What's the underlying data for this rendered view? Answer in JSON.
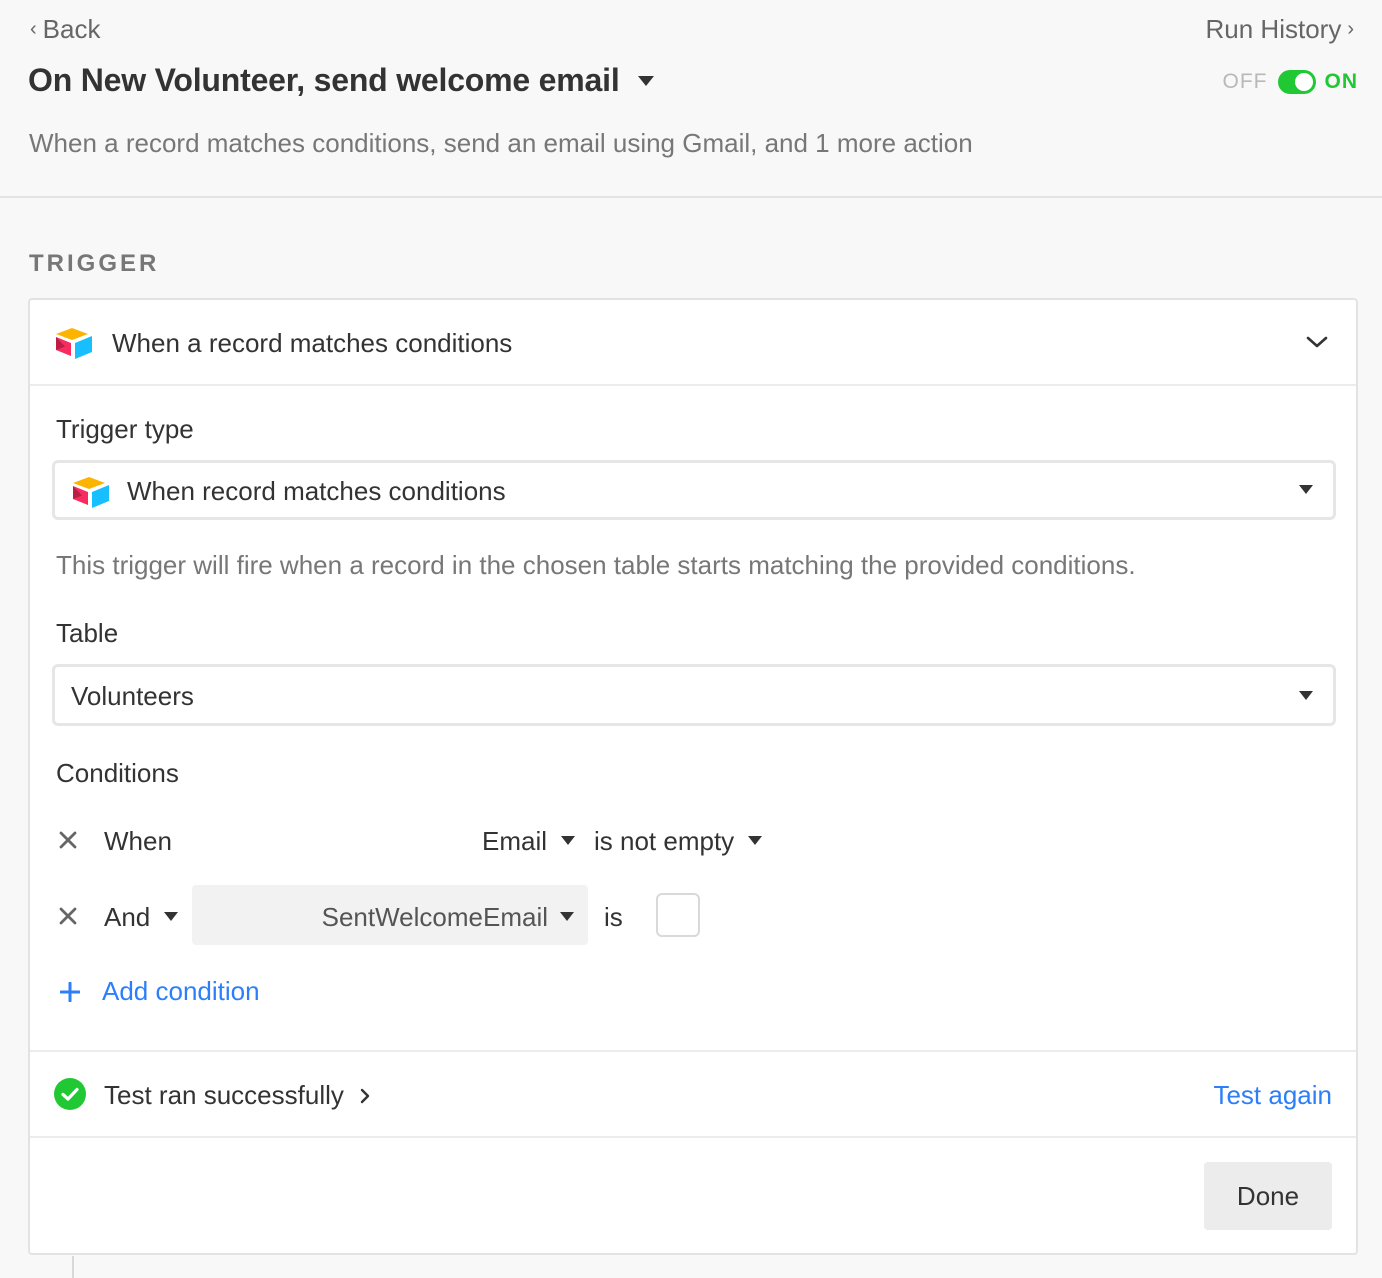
{
  "header": {
    "back_label": "Back",
    "run_history_label": "Run History",
    "title": "On New Volunteer, send welcome email",
    "toggle_off_label": "OFF",
    "toggle_on_label": "ON",
    "subtitle": "When a record matches conditions, send an email using Gmail, and 1 more action"
  },
  "trigger": {
    "section_label": "TRIGGER",
    "card_title": "When a record matches conditions",
    "trigger_type_label": "Trigger type",
    "trigger_type_value": "When record matches conditions",
    "help_text": "This trigger will fire when a record in the chosen table starts matching the provided conditions.",
    "table_label": "Table",
    "table_value": "Volunteers",
    "conditions_label": "Conditions",
    "conditions": [
      {
        "conjunction": "When",
        "field": "Email",
        "operator": "is not empty"
      },
      {
        "conjunction": "And",
        "field": "SentWelcomeEmail",
        "operator": "is",
        "checkbox_checked": false
      }
    ],
    "add_condition_label": "Add condition",
    "test_status": "Test ran successfully",
    "test_again_label": "Test again",
    "done_label": "Done"
  },
  "colors": {
    "accent_blue": "#2d7ff9",
    "toggle_green": "#20c933",
    "success_green": "#20c933"
  },
  "icons": {
    "back": "chevron-left-icon",
    "run_history": "chevron-right-icon",
    "title_menu": "caret-down-icon",
    "app": "airtable-logo-icon",
    "collapse": "chevron-down-icon",
    "remove": "close-icon",
    "add": "plus-icon",
    "success": "check-circle-icon"
  }
}
